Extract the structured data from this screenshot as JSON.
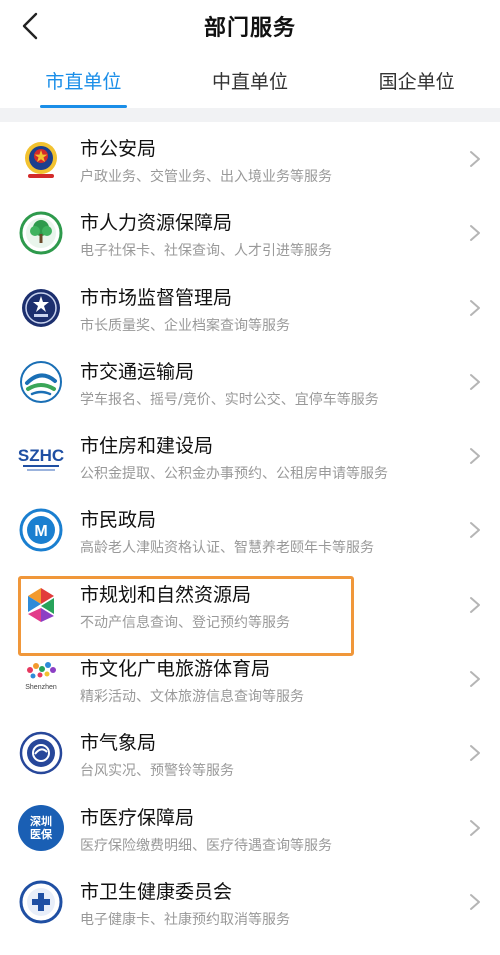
{
  "header": {
    "title": "部门服务",
    "back_icon": "chevron-left-icon"
  },
  "tabs": [
    {
      "label": "市直单位",
      "active": true
    },
    {
      "label": "中直单位",
      "active": false
    },
    {
      "label": "国企单位",
      "active": false
    }
  ],
  "departments": [
    {
      "name": "市公安局",
      "desc": "户政业务、交管业务、出入境业务等服务",
      "icon": "police-emblem-icon"
    },
    {
      "name": "市人力资源保障局",
      "desc": "电子社保卡、社保查询、人才引进等服务",
      "icon": "tree-emblem-icon"
    },
    {
      "name": "市市场监督管理局",
      "desc": "市长质量奖、企业档案查询等服务",
      "icon": "market-regulation-emblem-icon"
    },
    {
      "name": "市交通运输局",
      "desc": "学车报名、摇号/竞价、实时公交、宜停车等服务",
      "icon": "transport-emblem-icon"
    },
    {
      "name": "市住房和建设局",
      "desc": "公积金提取、公积金办事预约、公租房申请等服务",
      "icon": "szhc-logo-icon"
    },
    {
      "name": "市民政局",
      "desc": "高龄老人津贴资格认证、智慧养老颐年卡等服务",
      "icon": "civil-affairs-emblem-icon"
    },
    {
      "name": "市规划和自然资源局",
      "desc": "不动产信息查询、登记预约等服务",
      "icon": "planning-resources-logo-icon",
      "highlighted": true
    },
    {
      "name": "市文化广电旅游体育局",
      "desc": "精彩活动、文体旅游信息查询等服务",
      "icon": "shenzhen-culture-logo-icon",
      "logo_text": "Shenzhen"
    },
    {
      "name": "市气象局",
      "desc": "台风实况、预警铃等服务",
      "icon": "weather-emblem-icon"
    },
    {
      "name": "市医疗保障局",
      "desc": "医疗保险缴费明细、医疗待遇查询等服务",
      "icon": "medical-insurance-logo-icon",
      "logo_text": "深圳医保"
    },
    {
      "name": "市卫生健康委员会",
      "desc": "电子健康卡、社康预约取消等服务",
      "icon": "health-commission-emblem-icon"
    }
  ],
  "colors": {
    "accent": "#1a8ee8",
    "highlight": "#f0973a",
    "text": "#111111",
    "subtext": "#999999",
    "separator": "#f1f2f4"
  }
}
